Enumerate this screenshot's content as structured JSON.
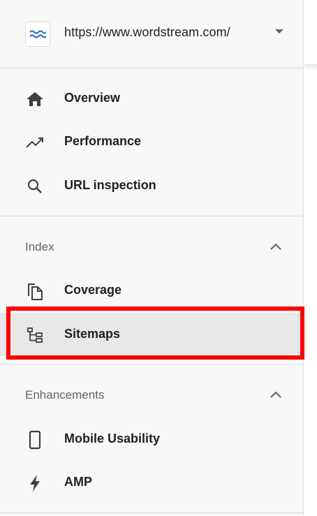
{
  "property": {
    "url": "https://www.wordstream.com/",
    "logo_icon": "wordstream-wave-logo",
    "dropdown_icon": "caret-down-icon"
  },
  "nav": {
    "overview": {
      "label": "Overview",
      "icon": "home-icon"
    },
    "performance": {
      "label": "Performance",
      "icon": "trending-up-icon"
    },
    "url_inspection": {
      "label": "URL inspection",
      "icon": "search-icon"
    }
  },
  "index_section": {
    "title": "Index",
    "icon": "chevron-up-icon",
    "items": [
      {
        "label": "Coverage",
        "icon": "copy-icon"
      },
      {
        "label": "Sitemaps",
        "icon": "sitemap-icon",
        "active": true
      }
    ]
  },
  "enhancements_section": {
    "title": "Enhancements",
    "icon": "chevron-up-icon",
    "items": [
      {
        "label": "Mobile Usability",
        "icon": "smartphone-icon"
      },
      {
        "label": "AMP",
        "icon": "bolt-icon"
      }
    ]
  },
  "colors": {
    "highlight_border": "#ff0000",
    "panel_bg": "#f8f8f8",
    "active_bg": "#e8e8e8",
    "text": "#202124",
    "muted": "#5f6368"
  }
}
